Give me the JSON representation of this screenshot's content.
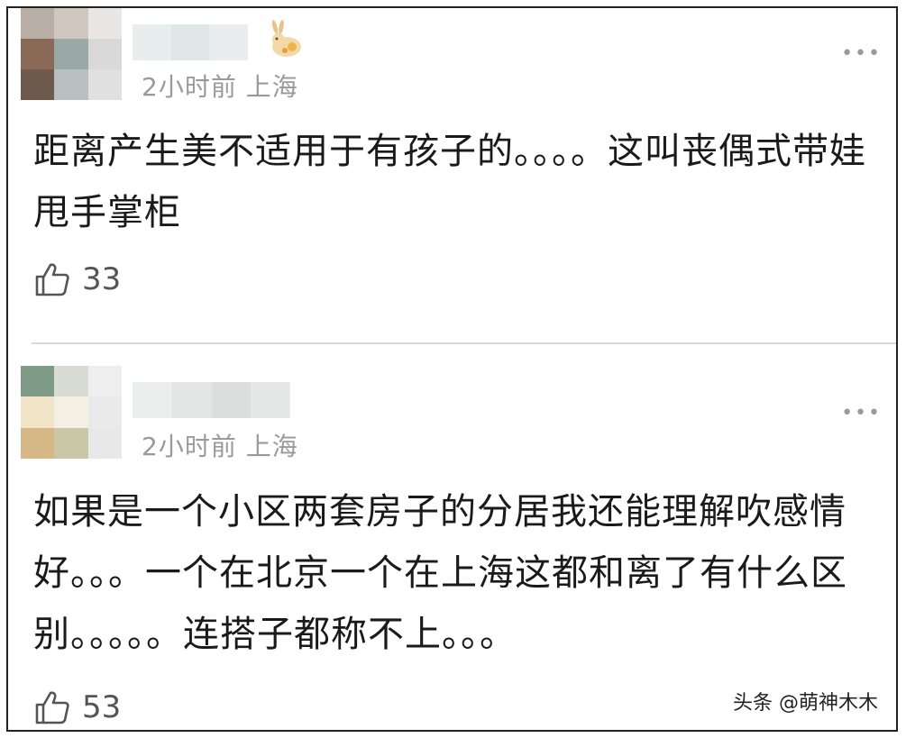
{
  "comments": [
    {
      "meta": "2小时前 上海",
      "text": "距离产生美不适用于有孩子的。。。。这叫丧偶式带娃甩手掌柜",
      "likes": "33",
      "avatar_colors": [
        "#b8aea6",
        "#cfc7c0",
        "#e9e6e3",
        "#8a6a56",
        "#9aa8a8",
        "#d9d9d9",
        "#6e5a4d",
        "#b9bec0",
        "#e0e0e0"
      ]
    },
    {
      "meta": "2小时前 上海",
      "text": "如果是一个小区两套房子的分居我还能理解吹感情好。。。一个在北京一个在上海这都和离了有什么区别。。。。。连搭子都称不上。。。",
      "likes": "53",
      "avatar_colors": [
        "#7f9a86",
        "#d9dcd2",
        "#eeeeee",
        "#f1e4c7",
        "#f6efe3",
        "#eaeaea",
        "#d6b886",
        "#c9c7a5",
        "#e8e8e8"
      ]
    }
  ],
  "more_label": "•••",
  "watermark": "头条 @萌神木木"
}
